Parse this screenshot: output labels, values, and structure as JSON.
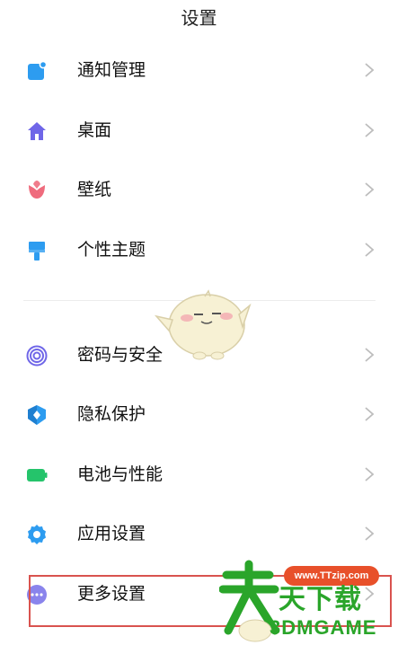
{
  "header": {
    "title": "设置"
  },
  "groups": [
    {
      "items": [
        {
          "label": "通知管理",
          "icon": "notification-icon",
          "color": "#2d9cf0"
        },
        {
          "label": "桌面",
          "icon": "home-icon",
          "color": "#6f66e8"
        },
        {
          "label": "壁纸",
          "icon": "tulip-icon",
          "color": "#ef6b7d"
        },
        {
          "label": "个性主题",
          "icon": "paint-brush-icon",
          "color": "#2d9cf0"
        }
      ]
    },
    {
      "items": [
        {
          "label": "密码与安全",
          "icon": "fingerprint-icon",
          "color": "#6f66e8"
        },
        {
          "label": "隐私保护",
          "icon": "privacy-shield-icon",
          "color": "#2d9cf0"
        },
        {
          "label": "电池与性能",
          "icon": "battery-icon",
          "color": "#25c46b"
        },
        {
          "label": "应用设置",
          "icon": "gear-icon",
          "color": "#2d9cf0"
        },
        {
          "label": "更多设置",
          "icon": "more-dots-icon",
          "color": "#6f66e8"
        }
      ]
    }
  ],
  "watermark": {
    "url": "www.TTzip.com",
    "cn": "天下载",
    "en": "3DMGAME"
  },
  "colors": {
    "chevron": "#bdbdbd",
    "highlight": "#d9534f",
    "watermark_green": "#2aa52a",
    "watermark_orange": "#e8502a"
  }
}
